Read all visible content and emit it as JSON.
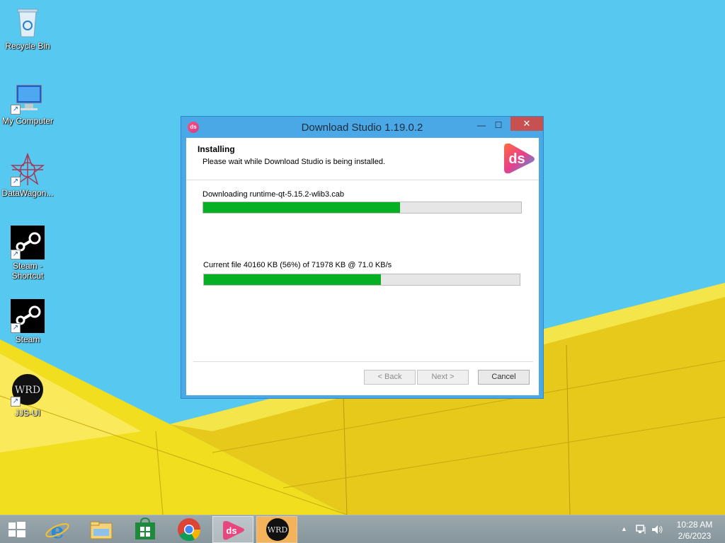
{
  "desktop": {
    "icons": [
      {
        "label": "Recycle Bin",
        "icon": "recycle-bin-icon"
      },
      {
        "label": "My Computer",
        "icon": "computer-icon"
      },
      {
        "label": "DataWagon...",
        "icon": "datawagon-icon"
      },
      {
        "label": "Steam - Shortcut",
        "icon": "steam-icon"
      },
      {
        "label": "Steam",
        "icon": "steam-icon"
      },
      {
        "label": "JJS-UI",
        "icon": "jjs-ui-icon"
      }
    ],
    "shortcut_glyph": "↗"
  },
  "dialog": {
    "title": "Download Studio 1.19.0.2",
    "title_icon_text": "ds",
    "controls": {
      "minimize": "—",
      "maximize": "☐",
      "close": "✕"
    },
    "header_title": "Installing",
    "header_subtitle": "Please wait while Download Studio is being installed.",
    "logo_text": "ds",
    "status_text": "Downloading runtime-qt-5.15.2-wlib3.cab",
    "overall_progress": 0.62,
    "file_status_text": "Current file 40160 KB (56%) of 71978 KB @ 71.0 KB/s",
    "file_progress": 0.56,
    "buttons": {
      "back": "< Back",
      "next": "Next >",
      "cancel": "Cancel"
    },
    "accent": "#06b025"
  },
  "taskbar": {
    "start_icon": "windows-start-icon",
    "pinned": [
      "internet-explorer-icon",
      "file-explorer-icon",
      "store-icon",
      "chrome-icon",
      "download-studio-icon",
      "jjs-ui-icon"
    ],
    "tray": {
      "expand": "▲"
    },
    "clock": {
      "time": "10:28 AM",
      "date": "2/6/2023"
    }
  }
}
